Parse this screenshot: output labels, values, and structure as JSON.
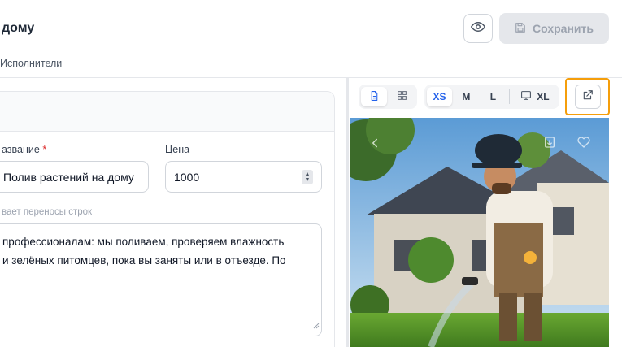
{
  "header": {
    "title": "дому",
    "save_label": "Сохранить"
  },
  "tabs": {
    "active_label": "Исполнители"
  },
  "form": {
    "name_label": "азвание",
    "name_required_mark": "*",
    "name_value": "Полив растений на дому",
    "price_label": "Цена",
    "price_value": "1000",
    "description_hint": "вает переносы строк",
    "description_line1": "профессионалам: мы поливаем, проверяем влажность",
    "description_line2": "и зелёных питомцев, пока вы заняты или в отъезде. По"
  },
  "preview": {
    "view_modes": [
      "document-icon",
      "grid-icon"
    ],
    "sizes": [
      "XS",
      "M",
      "L",
      "XL"
    ],
    "active_size": "XS",
    "accent_color": "#2563eb",
    "highlight_color": "#f59e0b"
  }
}
